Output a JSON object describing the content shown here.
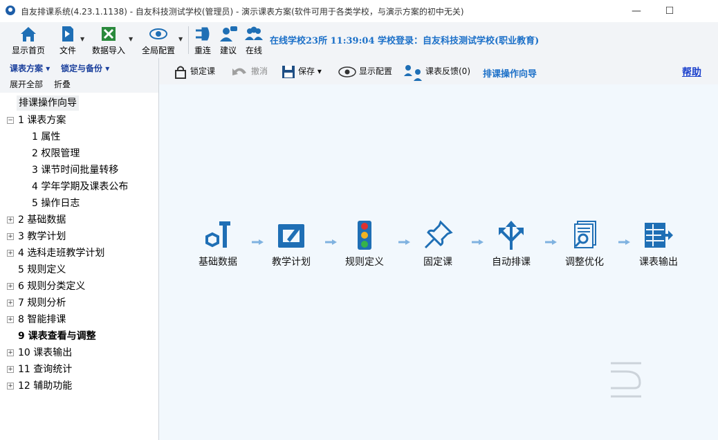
{
  "window": {
    "title": "自友排课系统(4.23.1.1138) - 自友科技测试学校(管理员) - 演示课表方案(软件可用于各类学校，与演示方案的初中无关)",
    "minimize": "—",
    "maximize": "☐"
  },
  "toolbar": {
    "home": "显示首页",
    "file": "文件",
    "import": "数据导入",
    "global_config": "全局配置",
    "reconnect": "重连",
    "suggest": "建议",
    "online": "在线",
    "status": "在线学校23所   11:39:04  学校登录：自友科技测试学校(职业教育)"
  },
  "sub_left": {
    "menu_plan": "课表方案",
    "menu_lock": "锁定与备份",
    "expand_all": "展开全部",
    "collapse": "折叠"
  },
  "action_bar": {
    "lock": "锁定课",
    "undo": "撤消",
    "save": "保存",
    "display_config": "显示配置",
    "feedback": "课表反馈(0)",
    "wizard_title": "排课操作向导",
    "help": "帮助"
  },
  "tree": {
    "header": "排课操作向导",
    "items": [
      {
        "label": "1  课表方案",
        "expander": "−"
      },
      {
        "label": "1  属性"
      },
      {
        "label": "2  权限管理"
      },
      {
        "label": "3  课节时间批量转移"
      },
      {
        "label": "4  学年学期及课表公布"
      },
      {
        "label": "5  操作日志"
      },
      {
        "label": "2  基础数据",
        "expander": "+"
      },
      {
        "label": "3  教学计划",
        "expander": "+"
      },
      {
        "label": "4  选科走班教学计划",
        "expander": "+"
      },
      {
        "label": "5  规则定义"
      },
      {
        "label": "6  规则分类定义",
        "expander": "+"
      },
      {
        "label": "7  规则分析",
        "expander": "+"
      },
      {
        "label": "8  智能排课",
        "expander": "+"
      },
      {
        "label": "9  课表查看与调整"
      },
      {
        "label": "10  课表输出",
        "expander": "+"
      },
      {
        "label": "11  查询统计",
        "expander": "+"
      },
      {
        "label": "12  辅助功能",
        "expander": "+"
      }
    ]
  },
  "workflow": {
    "steps": [
      {
        "label": "基础数据",
        "icon": "bolt-nut-icon"
      },
      {
        "label": "教学计划",
        "icon": "edit-board-icon"
      },
      {
        "label": "规则定义",
        "icon": "traffic-light-icon"
      },
      {
        "label": "固定课",
        "icon": "pushpin-icon"
      },
      {
        "label": "自动排课",
        "icon": "branch-arrows-icon"
      },
      {
        "label": "调整优化",
        "icon": "document-search-icon"
      },
      {
        "label": "课表输出",
        "icon": "table-export-icon"
      }
    ]
  },
  "colors": {
    "accent_blue": "#1c70c8",
    "icon_blue": "#1f6fb5",
    "canvas_bg": "#f2f8fd",
    "arrow": "#7fb2e0"
  }
}
